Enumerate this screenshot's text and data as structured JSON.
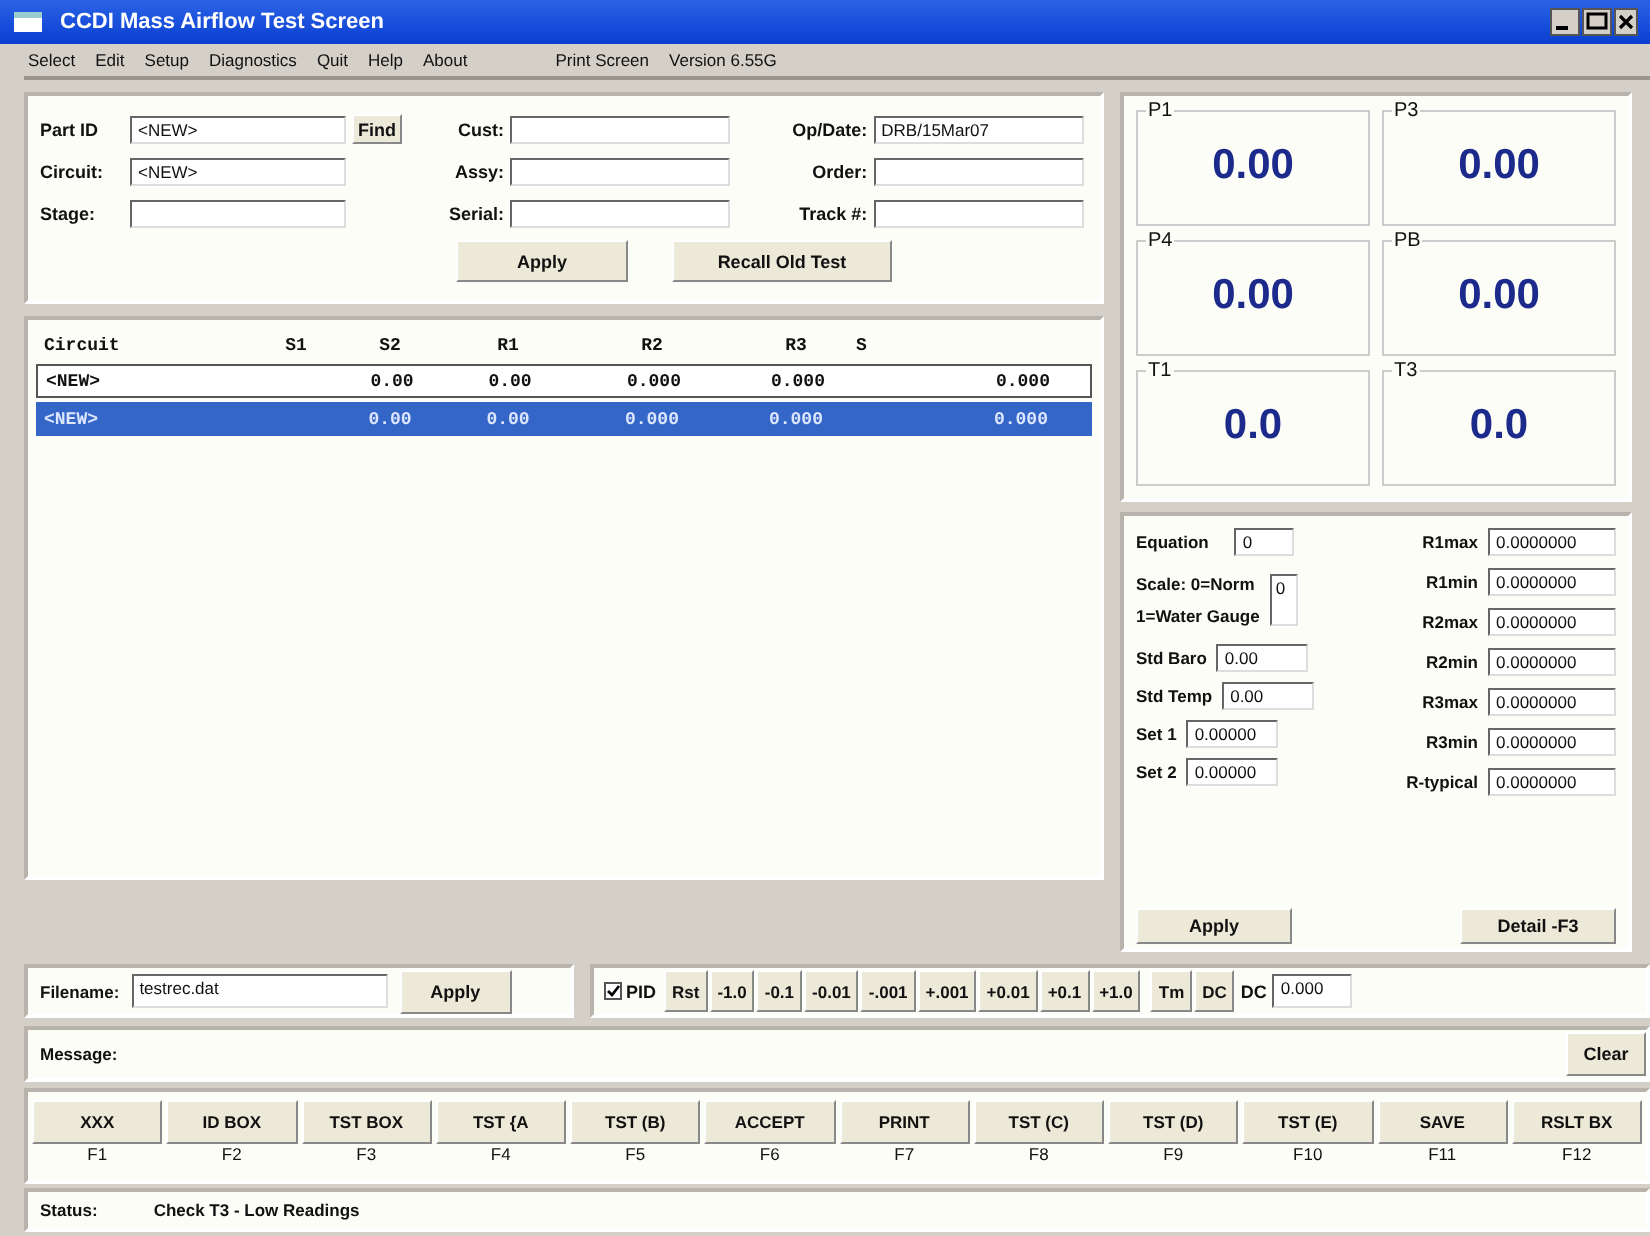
{
  "window": {
    "title": "CCDI Mass Airflow Test Screen"
  },
  "menu": [
    {
      "label": "Select"
    },
    {
      "label": "Edit"
    },
    {
      "label": "Setup"
    },
    {
      "label": "Diagnostics"
    },
    {
      "label": "Quit"
    },
    {
      "label": "Help"
    },
    {
      "label": "About"
    }
  ],
  "menu_right": {
    "print": "Print Screen",
    "version": "Version 6.55G"
  },
  "form": {
    "fields": [
      {
        "label": "Part ID",
        "value": "<NEW>"
      },
      {
        "label": "Cust:"
      },
      {
        "label": "Op/Date:",
        "value": "DRB/15Mar07"
      },
      {
        "label": "Circuit:",
        "value": "<NEW>"
      },
      {
        "label": "Assy:"
      },
      {
        "label": "Order:"
      },
      {
        "label": "Stage:"
      },
      {
        "label": "Serial:"
      },
      {
        "label": "Track #:"
      }
    ],
    "find": "Find",
    "buttons": [
      "Apply",
      "Recall Old Test"
    ]
  },
  "table": {
    "columns": [
      "Circuit",
      "S1",
      "S2",
      "R1",
      "R2",
      "R3",
      "S"
    ],
    "rows": [
      {
        "cells": [
          "<NEW>",
          "",
          "0.00",
          "0.00",
          "0.000",
          "0.000",
          "0.000"
        ],
        "selected": false
      },
      {
        "cells": [
          "<NEW>",
          "",
          "0.00",
          "0.00",
          "0.000",
          "0.000",
          "0.000"
        ],
        "selected": true
      }
    ]
  },
  "meters": [
    {
      "label": "P1",
      "value": "0.00"
    },
    {
      "label": "P3",
      "value": "0.00"
    },
    {
      "label": "P4",
      "value": "0.00"
    },
    {
      "label": "PB",
      "value": "0.00"
    },
    {
      "label": "T1",
      "value": "0.0"
    },
    {
      "label": "T3",
      "value": "0.0"
    }
  ],
  "params": {
    "left": [
      {
        "kind": "field",
        "label": "Equation",
        "value": "0"
      },
      {
        "kind": "scale",
        "label": "Scale: 0=Norm",
        "label2": "1=Water Gauge",
        "value": "0"
      },
      {
        "kind": "field",
        "label": "Std Baro",
        "value": "0.00"
      },
      {
        "kind": "field",
        "label": "Std Temp",
        "value": "0.00"
      },
      {
        "kind": "field",
        "label": "Set 1",
        "value": "0.00000"
      },
      {
        "kind": "field",
        "label": "Set 2",
        "value": "0.00000"
      }
    ],
    "right": [
      {
        "label": "R1max",
        "value": "0.0000000"
      },
      {
        "label": "R1min",
        "value": "0.0000000"
      },
      {
        "label": "R2max",
        "value": "0.0000000"
      },
      {
        "label": "R2min",
        "value": "0.0000000"
      },
      {
        "label": "R3max",
        "value": "0.0000000"
      },
      {
        "label": "R3min",
        "value": "0.0000000"
      },
      {
        "label": "R-typical",
        "value": "0.0000000"
      }
    ],
    "buttons": [
      "Apply",
      "Detail -F3"
    ]
  },
  "file_bar": {
    "label": "Filename:",
    "value": "testrec.dat",
    "apply": "Apply",
    "pid": {
      "label": "PID",
      "checked": true
    },
    "rst": "Rst",
    "steps": [
      "-1.0",
      "-0.1",
      "-0.01",
      "-.001",
      "+.001",
      "+0.01",
      "+0.1",
      "+1.0"
    ],
    "tm": "Tm",
    "dc_button": "DC",
    "dc_label": "DC",
    "dc_value": "0.000"
  },
  "message": {
    "label": "Message:",
    "clear": "Clear"
  },
  "function_keys": [
    {
      "label": "XXX",
      "key": "F1"
    },
    {
      "label": "ID BOX",
      "key": "F2"
    },
    {
      "label": "TST BOX",
      "key": "F3"
    },
    {
      "label": "TST {A",
      "key": "F4"
    },
    {
      "label": "TST (B)",
      "key": "F5"
    },
    {
      "label": "ACCEPT",
      "key": "F6"
    },
    {
      "label": "PRINT",
      "key": "F7"
    },
    {
      "label": "TST (C)",
      "key": "F8"
    },
    {
      "label": "TST (D)",
      "key": "F9"
    },
    {
      "label": "TST (E)",
      "key": "F10"
    },
    {
      "label": "SAVE",
      "key": "F11"
    },
    {
      "label": "RSLT BX",
      "key": "F12"
    }
  ],
  "status": {
    "label": "Status:",
    "text": "Check T3 - Low Readings"
  }
}
